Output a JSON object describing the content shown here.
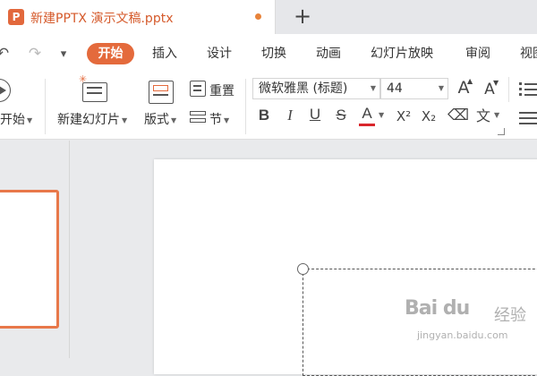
{
  "title_bar": {
    "app_logo": "P",
    "doc_title": "新建PPTX 演示文稿.pptx",
    "new_tab": "+"
  },
  "quick_access": {
    "undo": "↶",
    "redo": "↷",
    "more": "▾"
  },
  "menu": [
    "开始",
    "插入",
    "设计",
    "切换",
    "动画",
    "幻灯片放映",
    "审阅",
    "视图"
  ],
  "ribbon": {
    "start_show_label": "开始",
    "new_slide_label": "新建幻灯片",
    "layout_label": "版式",
    "reset_label": "重置",
    "section_label": "节",
    "font_name": "微软雅黑 (标题)",
    "font_size": "44",
    "grow_font": "A",
    "shrink_font": "A",
    "bold": "B",
    "italic": "I",
    "underline": "U",
    "strike": "S",
    "font_color": "A",
    "superscript": "X²",
    "subscript": "X₂",
    "clear_format": "⌫",
    "phonetic": "文"
  },
  "watermark": {
    "brand": "Bai du",
    "brand2": "经验",
    "url": "jingyan.baidu.com"
  },
  "colors": {
    "accent": "#e46a3c",
    "title": "#d55a2b",
    "font_color_bar": "#d9262c"
  }
}
